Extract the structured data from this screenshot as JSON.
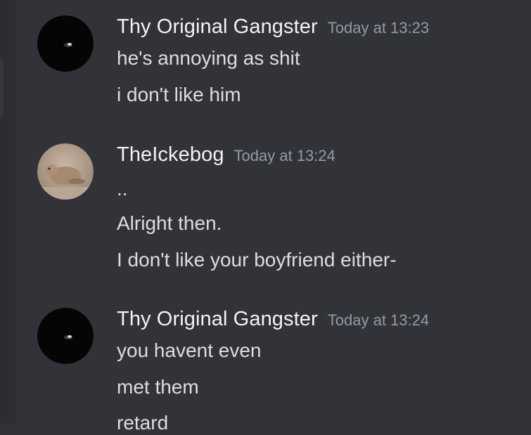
{
  "messages": [
    {
      "author": "Thy Original Gangster",
      "time": "Today at 13:23",
      "avatar_icon": "dark-cat-avatar",
      "lines": [
        "he's annoying as shit",
        "i don't like him"
      ]
    },
    {
      "author": "TheIckebog",
      "time": "Today at 13:24",
      "avatar_icon": "prairie-dog-avatar",
      "lines": [
        "..",
        "Alright then.",
        "I don't like your boyfriend either-"
      ]
    },
    {
      "author": "Thy Original Gangster",
      "time": "Today at 13:24",
      "avatar_icon": "dark-cat-avatar",
      "lines": [
        "you havent even",
        "met them",
        "retard"
      ]
    }
  ],
  "colors": {
    "background": "#313338",
    "username": "#f2f3f5",
    "timestamp": "#949ba4",
    "text": "#dbdee1"
  }
}
